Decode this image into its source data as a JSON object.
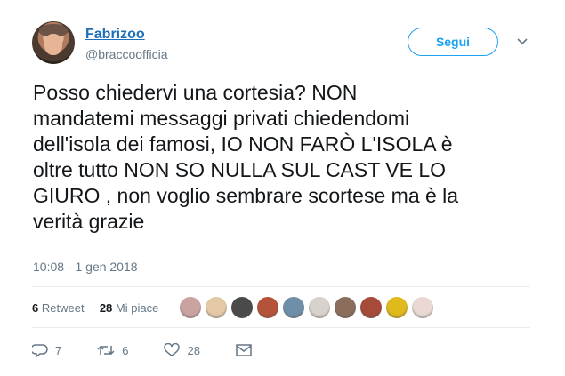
{
  "user": {
    "name": "Fabrizoo",
    "handle": "@braccoofficia"
  },
  "follow_label": "Segui",
  "tweet_text": "Posso chiedervi una cortesia? NON\nmandatemi messaggi privati chiedendomi\ndell'isola dei famosi, IO NON FARÒ L'ISOLA è\noltre tutto NON SO NULLA SUL CAST VE LO\nGIURO , non voglio sembrare scortese ma è la\nverità grazie",
  "timestamp": "10:08 - 1 gen 2018",
  "stats": {
    "retweets": "6",
    "retweets_label": "Retweet",
    "likes": "28",
    "likes_label": "Mi piace"
  },
  "liker_colors": [
    "#c9a3a0",
    "#e3c9a6",
    "#4a4a4a",
    "#b5523a",
    "#6f8fa8",
    "#d8d2cc",
    "#8a6d5a",
    "#a64a3a",
    "#e0b91c",
    "#e9d9d2"
  ],
  "actions": {
    "reply_count": "7",
    "retweet_count": "6",
    "like_count": "28"
  },
  "icons": [
    "chevron-down-icon",
    "reply-icon",
    "retweet-icon",
    "heart-icon",
    "mail-icon"
  ]
}
